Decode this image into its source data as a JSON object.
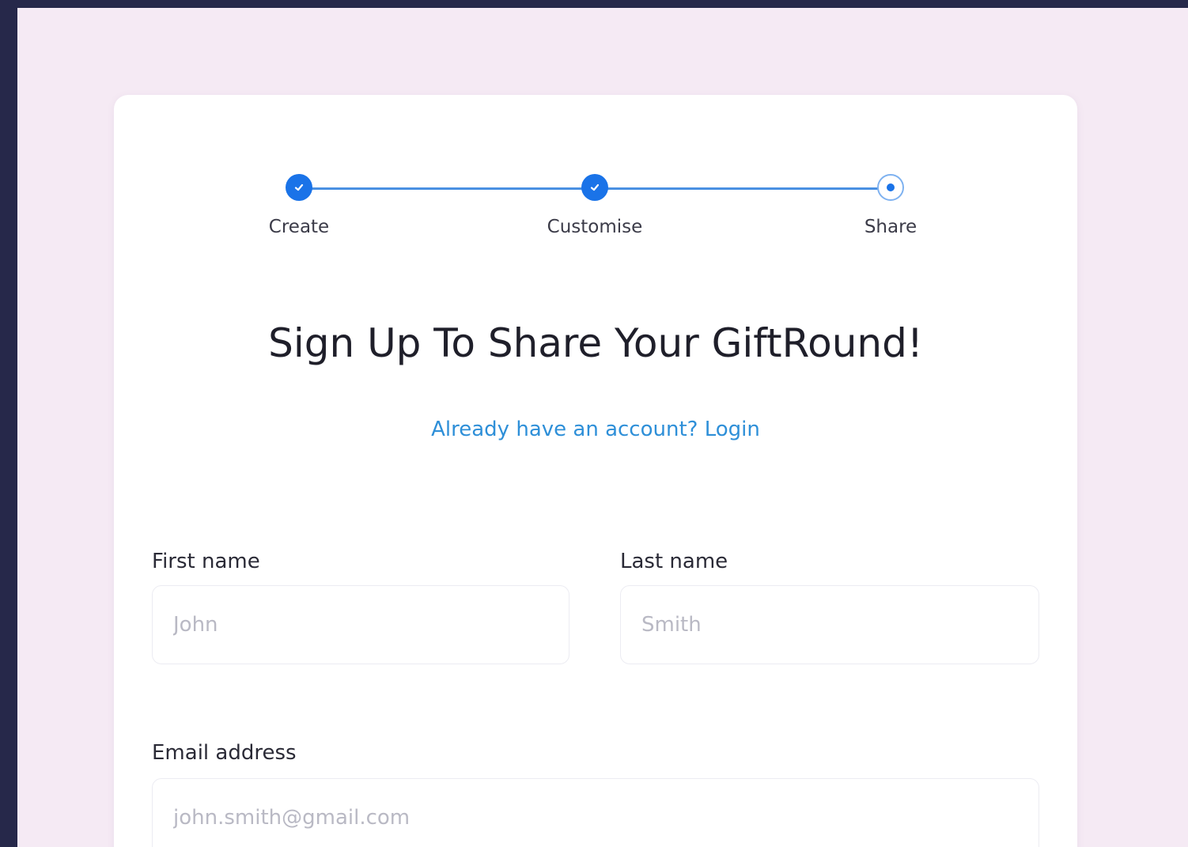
{
  "steps": [
    {
      "label": "Create",
      "state": "done"
    },
    {
      "label": "Customise",
      "state": "done"
    },
    {
      "label": "Share",
      "state": "current"
    }
  ],
  "heading": "Sign Up To Share Your GiftRound!",
  "login_link": "Already have an account? Login",
  "form": {
    "first_name": {
      "label": "First name",
      "placeholder": "John",
      "value": ""
    },
    "last_name": {
      "label": "Last name",
      "placeholder": "Smith",
      "value": ""
    },
    "email": {
      "label": "Email address",
      "placeholder": "john.smith@gmail.com",
      "value": ""
    }
  },
  "colors": {
    "accent": "#1a73e8",
    "link": "#2e8fd8",
    "page_bg": "#f5eaf4",
    "frame_bg": "#26284a"
  }
}
